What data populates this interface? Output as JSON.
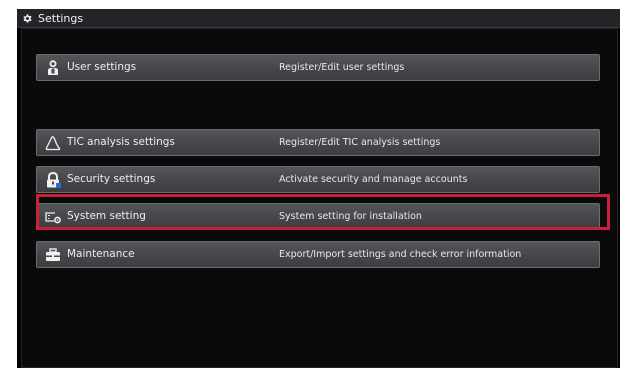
{
  "window": {
    "title": "Settings",
    "title_icon": "gear-icon"
  },
  "settings": [
    {
      "icon": "user-icon",
      "label": "User settings",
      "description": "Register/Edit user settings"
    },
    {
      "icon": "tic-curve-icon",
      "label": "TIC analysis settings",
      "description": "Register/Edit TIC analysis settings"
    },
    {
      "icon": "lock-icon",
      "label": "Security settings",
      "description": "Activate security and manage accounts"
    },
    {
      "icon": "system-icon",
      "label": "System setting",
      "description": "System setting for installation",
      "highlighted": true
    },
    {
      "icon": "toolbox-icon",
      "label": "Maintenance",
      "description": "Export/Import settings and check error information"
    }
  ],
  "colors": {
    "background": "#000000",
    "button": "#47494c",
    "highlight": "#c8203a"
  }
}
